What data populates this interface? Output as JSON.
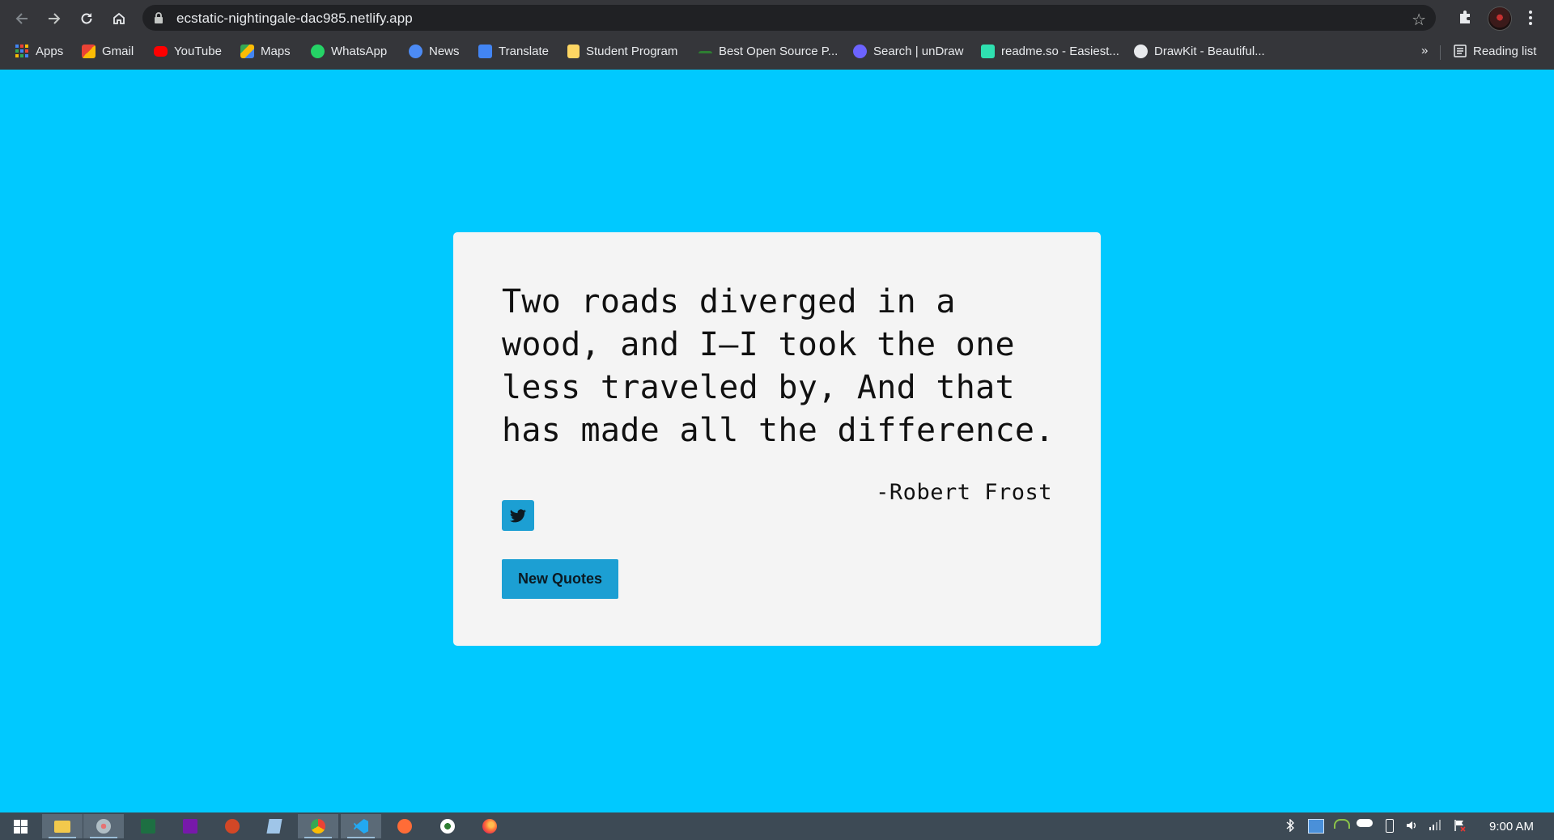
{
  "browser": {
    "url": "ecstatic-nightingale-dac985.netlify.app",
    "bookmarks": [
      {
        "label": "Apps",
        "color": "#4285f4"
      },
      {
        "label": "Gmail",
        "color": "#ea4335"
      },
      {
        "label": "YouTube",
        "color": "#ff0000"
      },
      {
        "label": "Maps",
        "color": "#34a853"
      },
      {
        "label": "WhatsApp",
        "color": "#25d366"
      },
      {
        "label": "News",
        "color": "#4c8bf5"
      },
      {
        "label": "Translate",
        "color": "#4285f4"
      },
      {
        "label": "Student Program",
        "color": "#fdd663"
      },
      {
        "label": "Best Open Source P...",
        "color": "#2e7d32"
      },
      {
        "label": "Search | unDraw",
        "color": "#6c63ff"
      },
      {
        "label": "readme.so - Easiest...",
        "color": "#2fe0b0"
      },
      {
        "label": "DrawKit - Beautiful...",
        "color": "#e8eaed"
      }
    ],
    "more_chevrons": "»",
    "reading_list": "Reading list"
  },
  "quote_card": {
    "text": "Two roads diverged in a wood, and I—I took the one less traveled by, And that has made all the difference.",
    "author": "-Robert Frost",
    "button_label": "New Quotes",
    "accent_color": "#1c9fd3",
    "background_color": "#00c9ff"
  },
  "taskbar": {
    "apps": [
      "start-icon",
      "file-explorer-icon",
      "paint-icon",
      "excel-icon",
      "onenote-icon",
      "powerpoint-icon",
      "notepad-icon",
      "chrome-icon",
      "vscode-icon",
      "postman-icon",
      "download-icon",
      "firefox-icon"
    ],
    "time": "9:00 AM"
  }
}
